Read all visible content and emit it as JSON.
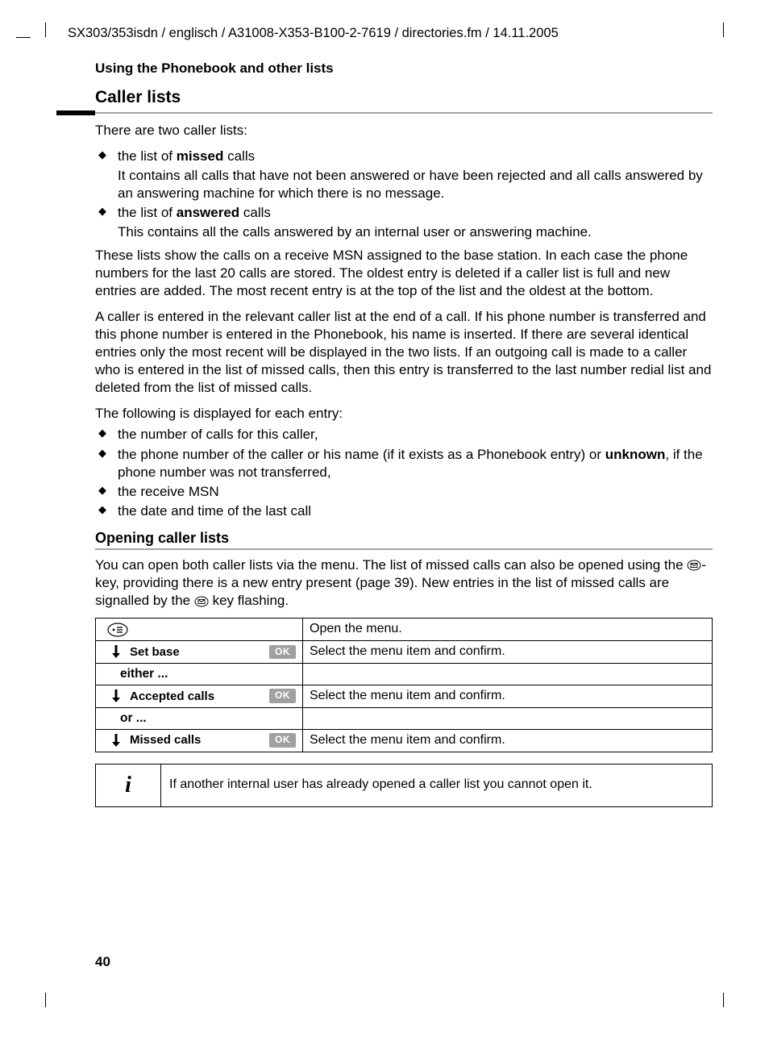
{
  "header_path": "SX303/353isdn / englisch / A31008-X353-B100-2-7619 / directories.fm / 14.11.2005",
  "section_title": "Using the Phonebook and other lists",
  "heading_caller_lists": "Caller lists",
  "intro": "There are two caller lists:",
  "bullets1": {
    "b1_pre": "the list of ",
    "b1_bold": "missed",
    "b1_post": " calls",
    "b1_sub": "It contains all calls that have not been answered or have been rejected and all calls answered by an answering machine for which there is no message.",
    "b2_pre": "the list of ",
    "b2_bold": "answered",
    "b2_post": " calls",
    "b2_sub": "This contains all the calls answered by an internal user or answering machine."
  },
  "para_lists_show": "These lists show the calls on a receive MSN assigned to the base station. In each case the phone numbers for the last 20 calls are stored. The oldest entry is deleted if a caller list is full and new entries are added. The most recent entry is at the top of the list and the oldest at the bottom.",
  "para_caller_entered": "A caller is entered in the relevant caller list at the end of a call. If his phone number is transferred and this phone number is entered in the Phonebook, his name is inserted. If there are several identical entries only the most recent will be displayed in the two lists. If an outgoing call is made to a caller who is entered in the list of missed calls, then this entry is transferred to the last number redial list and deleted from the list of missed calls.",
  "para_following": "The following is displayed for each entry:",
  "bullets2": {
    "b1": "the number of calls for this caller,",
    "b2_pre": "the phone number of the caller or his name (if it exists as a Phonebook entry) or ",
    "b2_bold": "unknown",
    "b2_post": ", if the phone number was not transferred,",
    "b3": "the receive MSN",
    "b4": "the date and time of the last call"
  },
  "heading_opening": "Opening caller lists",
  "opening_para": {
    "pre": "You can open both caller lists via the menu. The list of missed calls can also be opened using the ",
    "mid": "-key, providing there is a new entry present (page 39). New entries in the list of missed calls are signalled by the ",
    "post": " key flashing."
  },
  "steps": {
    "row1_right": "Open the menu.",
    "row2_label": "Set base",
    "row2_right": "Select the menu item and confirm.",
    "either": "either ...",
    "row3_label": "Accepted calls",
    "row3_right": "Select the menu item and confirm.",
    "or": "or ...",
    "row4_label": "Missed calls",
    "row4_right": "Select the menu item and confirm.",
    "ok": "OK"
  },
  "note_icon": "i",
  "note_text": "If another internal user has already opened a caller list you cannot open it.",
  "page_number": "40"
}
